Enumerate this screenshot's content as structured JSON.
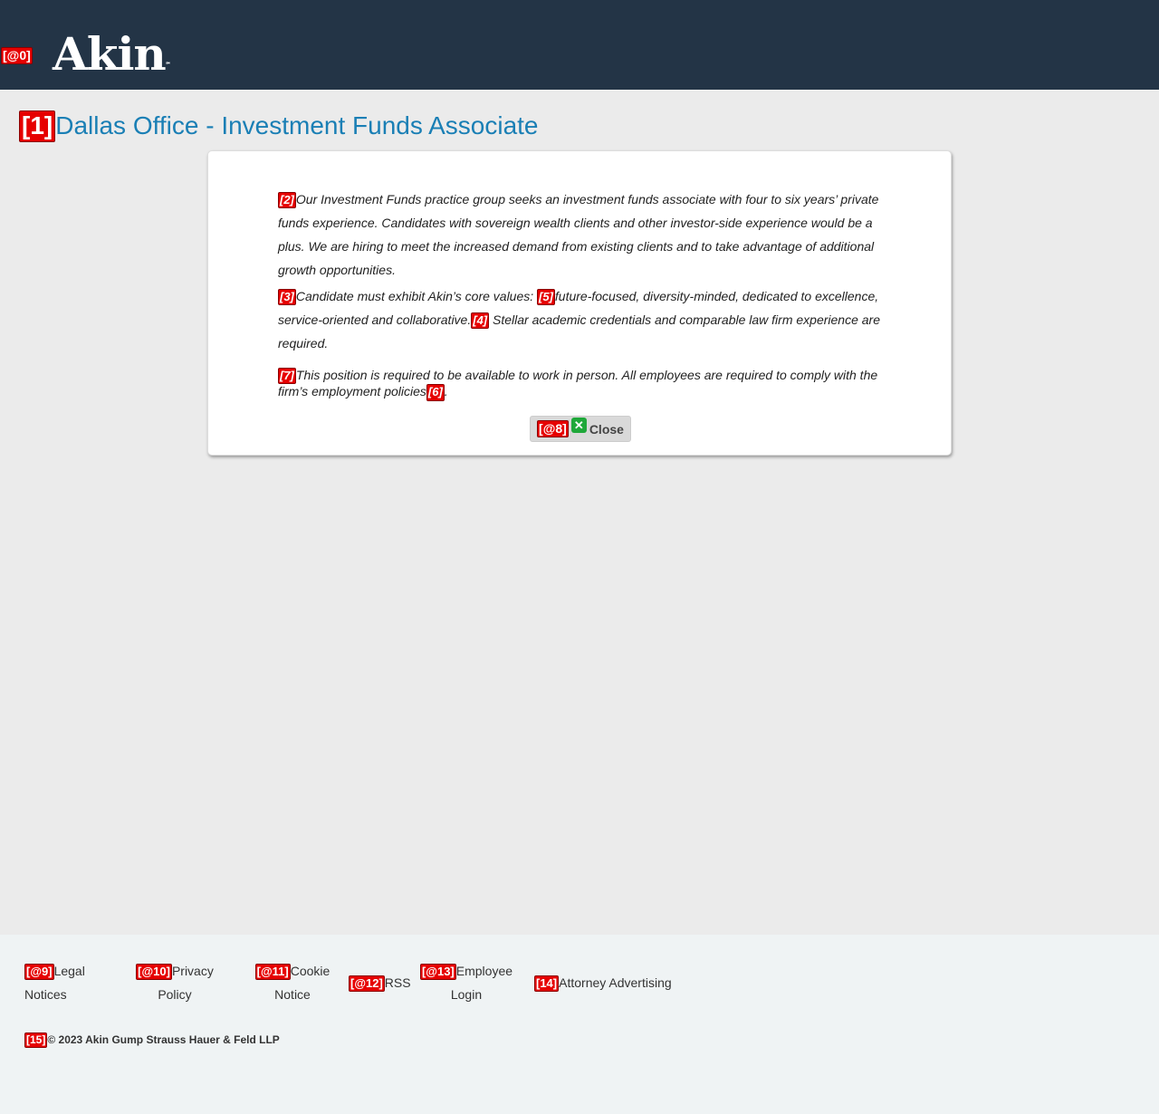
{
  "header": {
    "logo_tag": "[@0]",
    "logo_text": "Akin",
    "logo_mark": "℠"
  },
  "title": {
    "tag": "[1]",
    "text": "Dallas Office - Investment Funds Associate"
  },
  "modal": {
    "p1_tag": "[2]",
    "p1_text": "Our Investment Funds practice group seeks an investment funds associate with four to six years’ private funds experience.  Candidates with sovereign wealth clients and other investor-side experience would be a plus. We are hiring to meet the increased demand from existing clients and to take advantage of additional growth opportunities.",
    "p2_tag": "[3]",
    "p2_text_a": "Candidate must exhibit Akin’s core values: ",
    "p2_tag_b": "[5]",
    "p2_text_b": "future-focused, diversity-minded, dedicated to excellence, service-oriented and collaborative.",
    "p2_tag_c": "[4]",
    "p2_text_c": " Stellar academic credentials and comparable law firm experience are required.",
    "p3_tag": "[7]",
    "p3_text_a": "This position is required to be available to work in person. All employees are required to comply with the firm’s employment policies",
    "p3_tag_b": "[6]",
    "p3_text_b": ".",
    "close_tag": "[@8]",
    "close_icon": "✕",
    "close_label": "Close"
  },
  "footer": {
    "links": [
      {
        "tag": "[@9]",
        "label_a": "Legal",
        "label_b": "Notices"
      },
      {
        "tag": "[@10]",
        "label_a": "Privacy",
        "label_b": "Policy"
      },
      {
        "tag": "[@11]",
        "label_a": "Cookie",
        "label_b": "Notice"
      },
      {
        "tag": "[@12]",
        "label_a": "RSS"
      },
      {
        "tag": "[@13]",
        "label_a": "Employee",
        "label_b": "Login"
      },
      {
        "tag": "[14]",
        "label_a": "Attorney Advertising"
      }
    ],
    "copyright_tag": "[15]",
    "copyright": "© 2023 Akin Gump Strauss Hauer & Feld LLP"
  },
  "colors": {
    "header_bg": "#233446",
    "title_color": "#1a7fb5",
    "tag_red": "#e60000",
    "close_icon_green": "#1fa83a"
  }
}
